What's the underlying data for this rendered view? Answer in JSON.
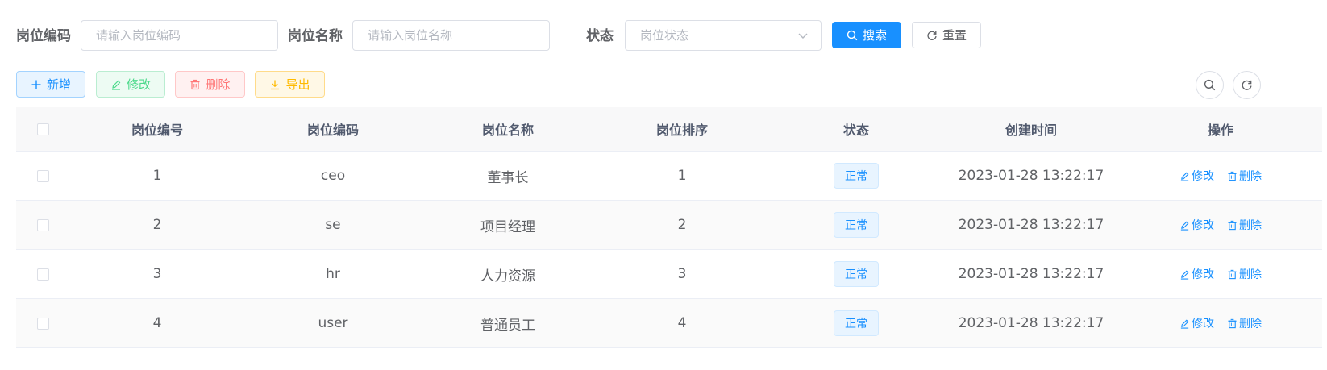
{
  "search": {
    "code_label": "岗位编码",
    "code_placeholder": "请输入岗位编码",
    "name_label": "岗位名称",
    "name_placeholder": "请输入岗位名称",
    "status_label": "状态",
    "status_placeholder": "岗位状态",
    "search_button": "搜索",
    "reset_button": "重置"
  },
  "toolbar": {
    "add": "新增",
    "edit": "修改",
    "delete": "删除",
    "export": "导出"
  },
  "table": {
    "columns": [
      "岗位编号",
      "岗位编码",
      "岗位名称",
      "岗位排序",
      "状态",
      "创建时间",
      "操作"
    ],
    "rows": [
      {
        "id": "1",
        "code": "ceo",
        "name": "董事长",
        "sort": "1",
        "status": "正常",
        "created": "2023-01-28 13:22:17"
      },
      {
        "id": "2",
        "code": "se",
        "name": "项目经理",
        "sort": "2",
        "status": "正常",
        "created": "2023-01-28 13:22:17"
      },
      {
        "id": "3",
        "code": "hr",
        "name": "人力资源",
        "sort": "3",
        "status": "正常",
        "created": "2023-01-28 13:22:17"
      },
      {
        "id": "4",
        "code": "user",
        "name": "普通员工",
        "sort": "4",
        "status": "正常",
        "created": "2023-01-28 13:22:17"
      }
    ],
    "row_actions": {
      "edit": "修改",
      "delete": "删除"
    }
  },
  "colors": {
    "primary": "#1890ff",
    "success": "#13ce66",
    "danger": "#ff4949",
    "warning": "#ffba00"
  },
  "icons": {
    "add": "plus-icon",
    "edit": "edit-icon",
    "delete": "trash-icon",
    "export": "download-icon",
    "search": "search-icon",
    "reset": "refresh-icon",
    "select": "chevron-down-icon"
  }
}
